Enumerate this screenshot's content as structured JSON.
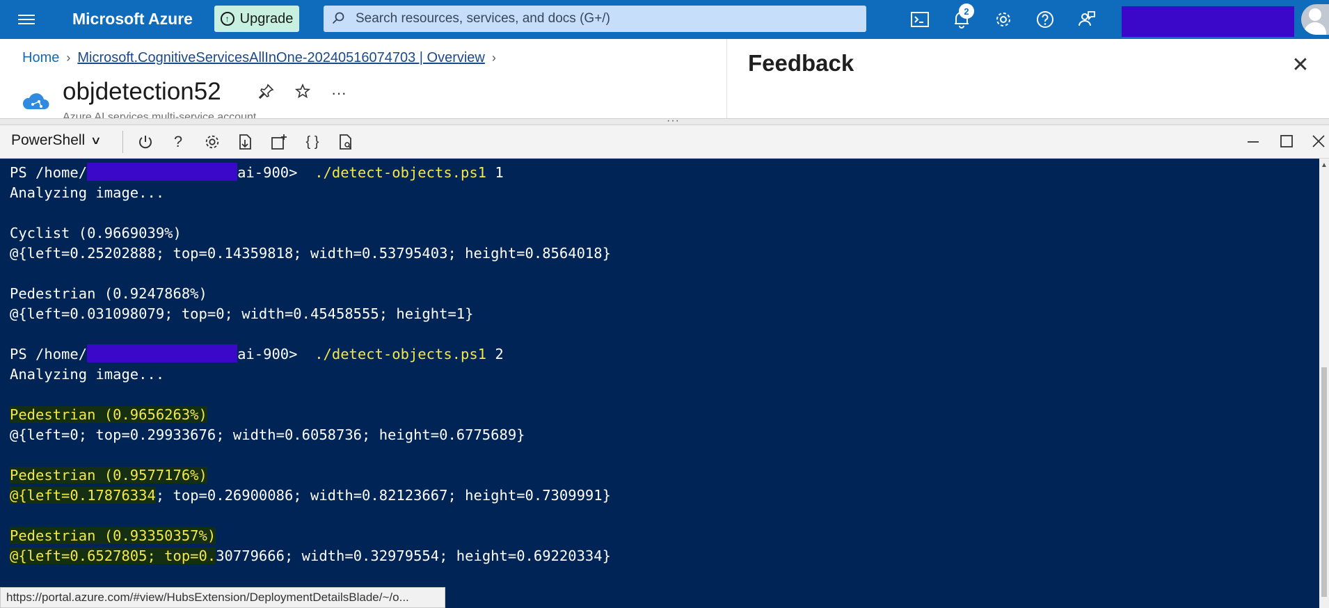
{
  "topbar": {
    "brand": "Microsoft Azure",
    "upgrade_label": "Upgrade",
    "search_placeholder": "Search resources, services, and docs (G+/)",
    "notification_count": "2",
    "colors": {
      "bar": "#0f6cbd",
      "upgrade_bg": "#c7f0e1",
      "search_bg": "#c6defa"
    }
  },
  "breadcrumb": {
    "home": "Home",
    "deployment": "Microsoft.CognitiveServicesAllInOne-20240516074703 | Overview"
  },
  "resource": {
    "name": "objdetection52",
    "subtitle": "Azure AI services multi-service account",
    "more": "···"
  },
  "feedback": {
    "title": "Feedback"
  },
  "shell": {
    "selected": "PowerShell",
    "icons": [
      "power-icon",
      "help-icon",
      "settings-icon",
      "upload-download-icon",
      "new-session-icon",
      "editor-icon",
      "web-preview-icon"
    ]
  },
  "terminal": {
    "prompt_prefix": "PS /home/",
    "prompt_suffix": "ai-900> ",
    "run1": {
      "command": "./detect-objects.ps1",
      "arg": "1",
      "analyzing": "Analyzing image...",
      "results": [
        {
          "label": "Cyclist (0.9669039%)",
          "box": "@{left=0.25202888; top=0.14359818; width=0.53795403; height=0.8564018}"
        },
        {
          "label": "Pedestrian (0.9247868%)",
          "box": "@{left=0.031098079; top=0; width=0.45458555; height=1}"
        }
      ]
    },
    "run2": {
      "command": "./detect-objects.ps1",
      "arg": "2",
      "analyzing": "Analyzing image...",
      "results": [
        {
          "label": "Pedestrian (0.9656263%)",
          "box_hl": "",
          "box": "@{left=0; top=0.29933676; width=0.6058736; height=0.6775689}"
        },
        {
          "label": "Pedestrian (0.9577176%)",
          "box_hl": "@{left=0.17876334",
          "box": "; top=0.26900086; width=0.82123667; height=0.7309991}"
        },
        {
          "label": "Pedestrian (0.93350357%)",
          "box_hl": "@{left=0.6527805; top=0.",
          "box": "30779666; width=0.32979554; height=0.69220334}"
        }
      ]
    },
    "colors": {
      "background": "#012456",
      "command": "#f4e74a",
      "highlight": "#142f12"
    }
  },
  "statusbar": {
    "url": "https://portal.azure.com/#view/HubsExtension/DeploymentDetailsBlade/~/o..."
  }
}
